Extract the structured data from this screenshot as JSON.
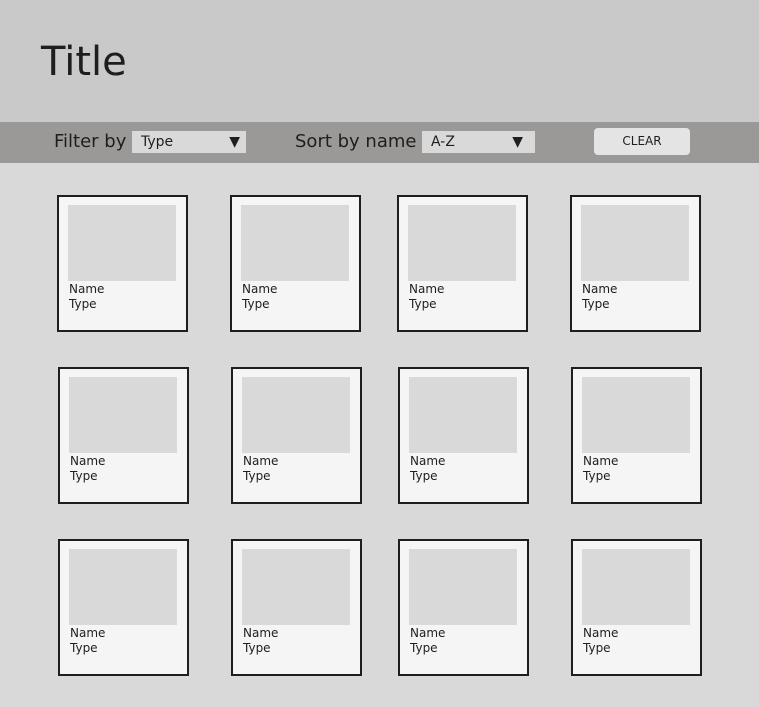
{
  "header": {
    "title": "Title"
  },
  "toolbar": {
    "filter_label": "Filter by",
    "filter_value": "Type",
    "sort_label": "Sort by name",
    "sort_value": "A-Z",
    "dropdown_arrow": "▼",
    "clear_label": "CLEAR"
  },
  "cards": [
    {
      "name": "Name",
      "type": "Type"
    },
    {
      "name": "Name",
      "type": "Type"
    },
    {
      "name": "Name",
      "type": "Type"
    },
    {
      "name": "Name",
      "type": "Type"
    },
    {
      "name": "Name",
      "type": "Type"
    },
    {
      "name": "Name",
      "type": "Type"
    },
    {
      "name": "Name",
      "type": "Type"
    },
    {
      "name": "Name",
      "type": "Type"
    },
    {
      "name": "Name",
      "type": "Type"
    },
    {
      "name": "Name",
      "type": "Type"
    },
    {
      "name": "Name",
      "type": "Type"
    },
    {
      "name": "Name",
      "type": "Type"
    }
  ]
}
